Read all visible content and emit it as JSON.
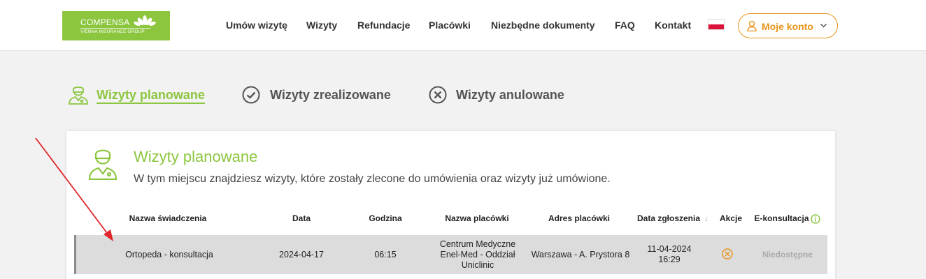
{
  "logo": {
    "name": "COMPENSA",
    "sub": "VIENNA INSURANCE GROUP"
  },
  "nav": {
    "items": [
      {
        "label": "Umów wizytę"
      },
      {
        "label": "Wizyty"
      },
      {
        "label": "Refundacje"
      },
      {
        "label": "Placówki"
      },
      {
        "label": "Niezbędne dokumenty"
      },
      {
        "label": "FAQ"
      },
      {
        "label": "Kontakt"
      }
    ],
    "flag": "pl-flag-icon",
    "account_label": "Moje konto"
  },
  "tabs": [
    {
      "label": "Wizyty planowane",
      "icon": "doctor-icon",
      "active": true
    },
    {
      "label": "Wizyty zrealizowane",
      "icon": "check-circle-icon",
      "active": false
    },
    {
      "label": "Wizyty anulowane",
      "icon": "x-circle-icon",
      "active": false
    }
  ],
  "card": {
    "title": "Wizyty planowane",
    "description": "W tym miejscu znajdziesz wizyty, które zostały zlecone do umówienia oraz wizyty już umówione."
  },
  "table": {
    "columns": [
      "Nazwa świadczenia",
      "Data",
      "Godzina",
      "Nazwa placówki",
      "Adres placówki",
      "Data zgłoszenia",
      "Akcje",
      "E-konsultacja"
    ],
    "sort_indicator": "↓",
    "rows": [
      {
        "service": "Ortopeda - konsultacja",
        "date": "2024-04-17",
        "time": "06:15",
        "facility_lines": [
          "Centrum Medyczne",
          "Enel-Med - Oddział",
          "Uniclinic"
        ],
        "address": "Warszawa - A. Prystora 8",
        "submitted_date": "11-04-2024",
        "submitted_time": "16:29",
        "action_icon": "cancel-circle-icon",
        "econsult": "Niedostępne"
      }
    ]
  },
  "colors": {
    "brand_green": "#8cc63f",
    "accent_orange": "#e8941a",
    "annotation_red": "#e0262b"
  }
}
